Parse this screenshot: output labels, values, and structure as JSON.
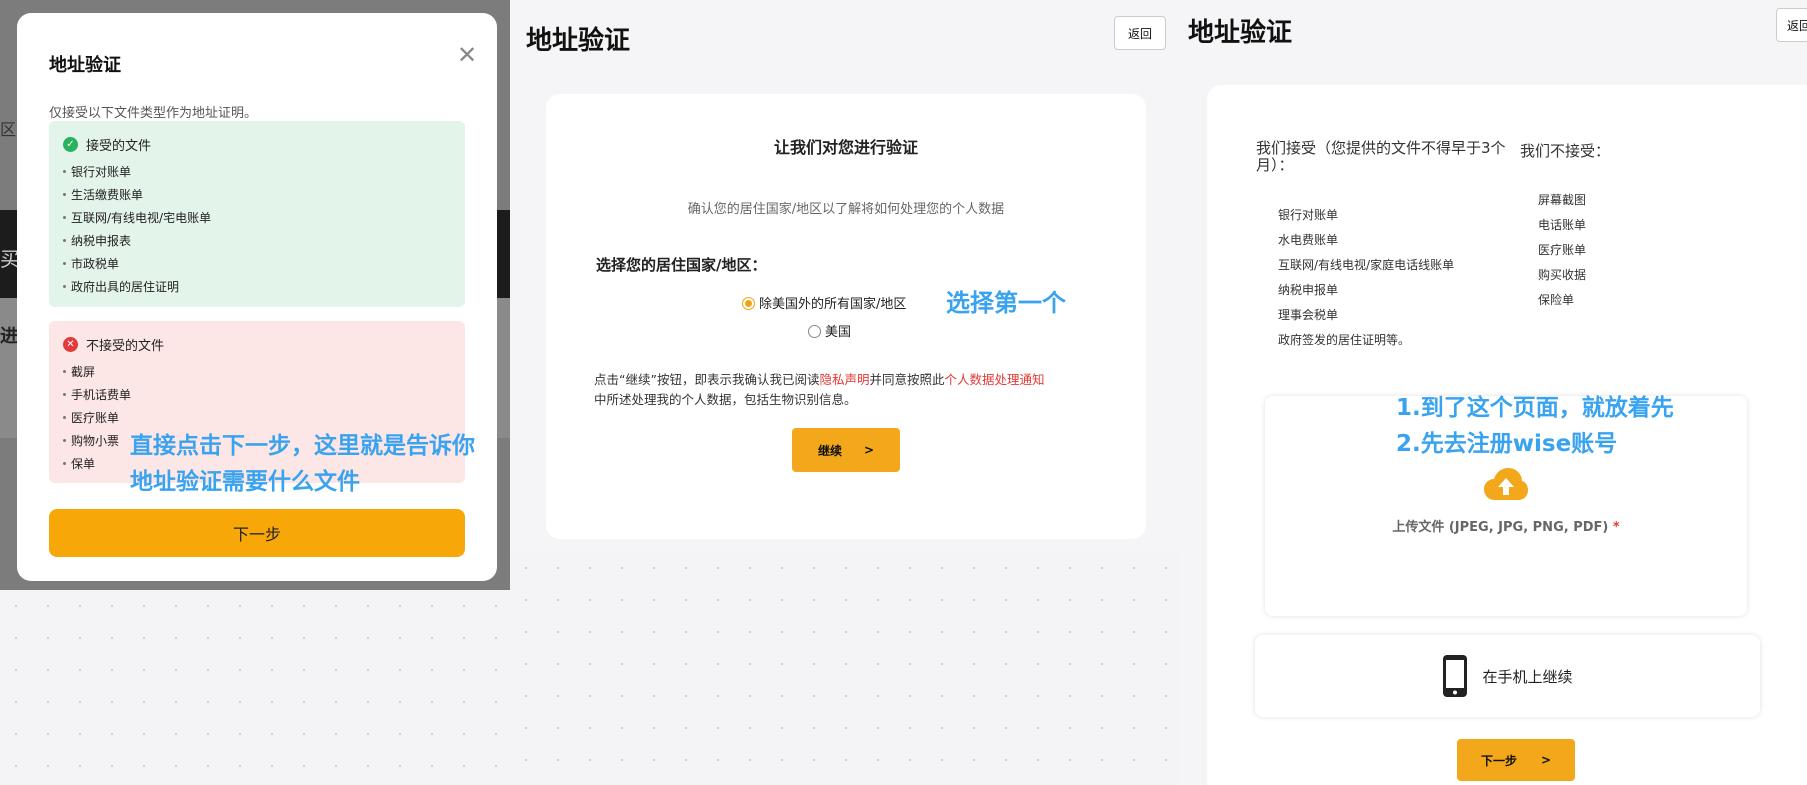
{
  "modal": {
    "title": "地址验证",
    "close_icon": "close-icon",
    "intro": "仅接受以下文件类型作为地址证明。",
    "accepted_title": "接受的文件",
    "accepted_items": [
      "银行对账单",
      "生活缴费账单",
      "互联网/有线电视/宅电账单",
      "纳税申报表",
      "市政税单",
      "政府出具的居住证明"
    ],
    "rejected_title": "不接受的文件",
    "rejected_items": [
      "截屏",
      "手机话费单",
      "医疗账单",
      "购物小票",
      "保单"
    ],
    "next_label": "下一步",
    "bg_fragments": [
      "区",
      "买",
      "进"
    ]
  },
  "verify": {
    "title": "地址验证",
    "back_label": "返回",
    "card_title": "让我们对您进行验证",
    "card_subtitle": "确认您的居住国家/地区以了解将如何处理您的个人数据",
    "select_label": "选择您的居住国家/地区：",
    "option_1": "除美国外的所有国家/地区",
    "option_2": "美国",
    "consent_prefix": "点击“继续”按钮，即表示我确认我已阅读",
    "privacy_link": "隐私声明",
    "consent_mid": "并同意按照此",
    "data_notice_link": "个人数据处理通知",
    "consent_suffix": "中所述处理我的个人数据，包括生物识别信息。",
    "continue_label": "继续",
    "continue_arrow": ">"
  },
  "upload": {
    "title": "地址验证",
    "back_label": "返回",
    "accept_heading": "我们接受（您提供的文件不得早于3个月）：",
    "reject_heading": "我们不接受：",
    "accept_items": [
      "银行对账单",
      "水电费账单",
      "互联网/有线电视/家庭电话线账单",
      "纳税申报单",
      "理事会税单",
      "政府签发的居住证明等。"
    ],
    "reject_items": [
      "屏幕截图",
      "电话账单",
      "医疗账单",
      "购买收据",
      "保险单"
    ],
    "upload_label": "上传文件 (JPEG, JPG, PNG, PDF)",
    "required_mark": "*",
    "cloud_icon": "cloud-upload-icon",
    "phone_icon": "smartphone-icon",
    "phone_label": "在手机上继续",
    "next_label": "下一步",
    "next_arrow": ">"
  },
  "annotations": {
    "modal_note_line1": "直接点击下一步，这里就是告诉你",
    "modal_note_line2": "地址验证需要什么文件",
    "verify_note": "选择第一个",
    "upload_note_line1": "1.到了这个页面，就放着先",
    "upload_note_line2": "2.先去注册wise账号"
  },
  "colors": {
    "accent": "#f7a808",
    "annotation": "#3aa3f0",
    "accepted_bg": "#e3f4ea",
    "rejected_bg": "#fde6e6",
    "link_red": "#e53935"
  }
}
